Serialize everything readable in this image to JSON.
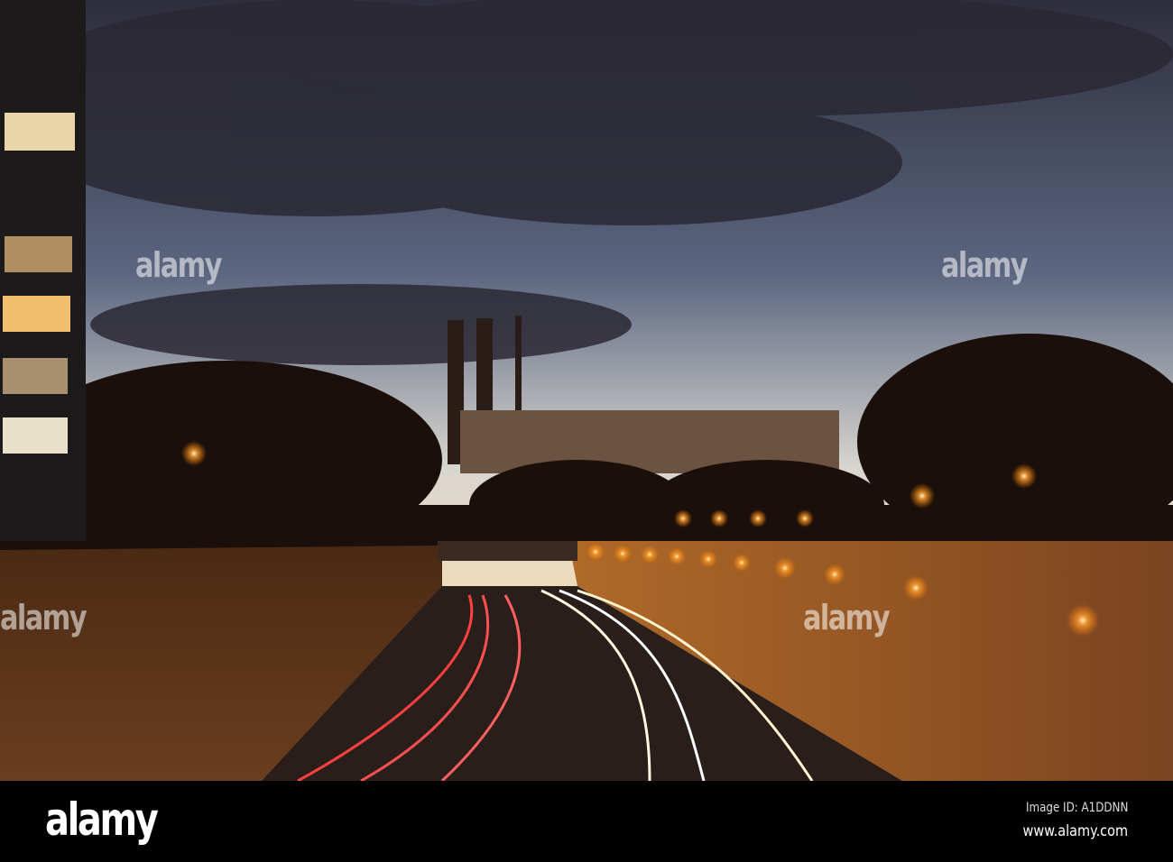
{
  "watermark": {
    "text": "alamy"
  },
  "footer": {
    "logo": "alamy",
    "image_id": "Image ID: A1DDNN",
    "url": "www.alamy.com"
  },
  "colors": {
    "sky_top": "#3a3a4a",
    "sky_horizon": "#f3dcb8",
    "wall": "#7a4a22",
    "lamp": "#ffb040"
  }
}
